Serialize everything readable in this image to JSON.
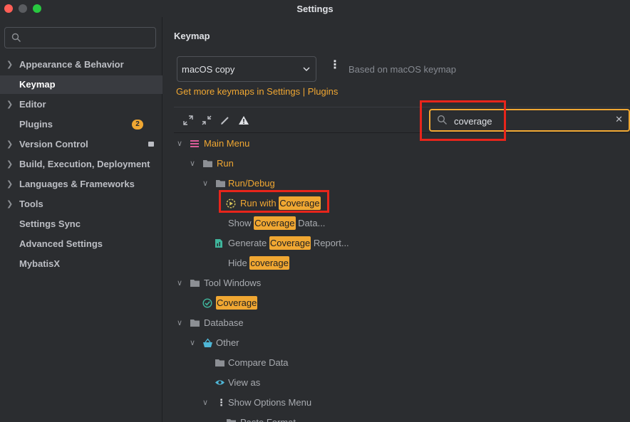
{
  "window": {
    "title": "Settings"
  },
  "sidebar": {
    "search_placeholder": "",
    "items": [
      {
        "label": "Appearance & Behavior",
        "expandable": true
      },
      {
        "label": "Keymap",
        "selected": true
      },
      {
        "label": "Editor",
        "expandable": true
      },
      {
        "label": "Plugins",
        "badge": "2"
      },
      {
        "label": "Version Control",
        "expandable": true
      },
      {
        "label": "Build, Execution, Deployment",
        "expandable": true
      },
      {
        "label": "Languages & Frameworks",
        "expandable": true
      },
      {
        "label": "Tools",
        "expandable": true
      },
      {
        "label": "Settings Sync"
      },
      {
        "label": "Advanced Settings"
      },
      {
        "label": "MybatisX"
      }
    ]
  },
  "main": {
    "title": "Keymap",
    "keymap_value": "macOS copy",
    "based_on": "Based on macOS keymap",
    "get_more_link": "Get more keymaps in Settings | Plugins",
    "filter_value": "coverage"
  },
  "tree": {
    "main_menu": "Main Menu",
    "run": "Run",
    "run_debug": "Run/Debug",
    "run_with_prefix": "Run with ",
    "run_with_match": "Coverage",
    "show_prefix": "Show ",
    "show_match": "Coverage",
    "show_suffix": " Data...",
    "generate_prefix": "Generate ",
    "generate_match": "Coverage",
    "generate_suffix": " Report...",
    "hide_prefix": "Hide ",
    "hide_match": "coverage",
    "tool_windows": "Tool Windows",
    "coverage_window": "Coverage",
    "database": "Database",
    "other": "Other",
    "compare_data": "Compare Data",
    "view_as": "View as",
    "show_options_menu": "Show Options Menu",
    "paste_format": "Paste Format"
  },
  "colors": {
    "accent": "#f0a732",
    "annotation_red": "#e8251b",
    "background": "#2b2d30"
  }
}
